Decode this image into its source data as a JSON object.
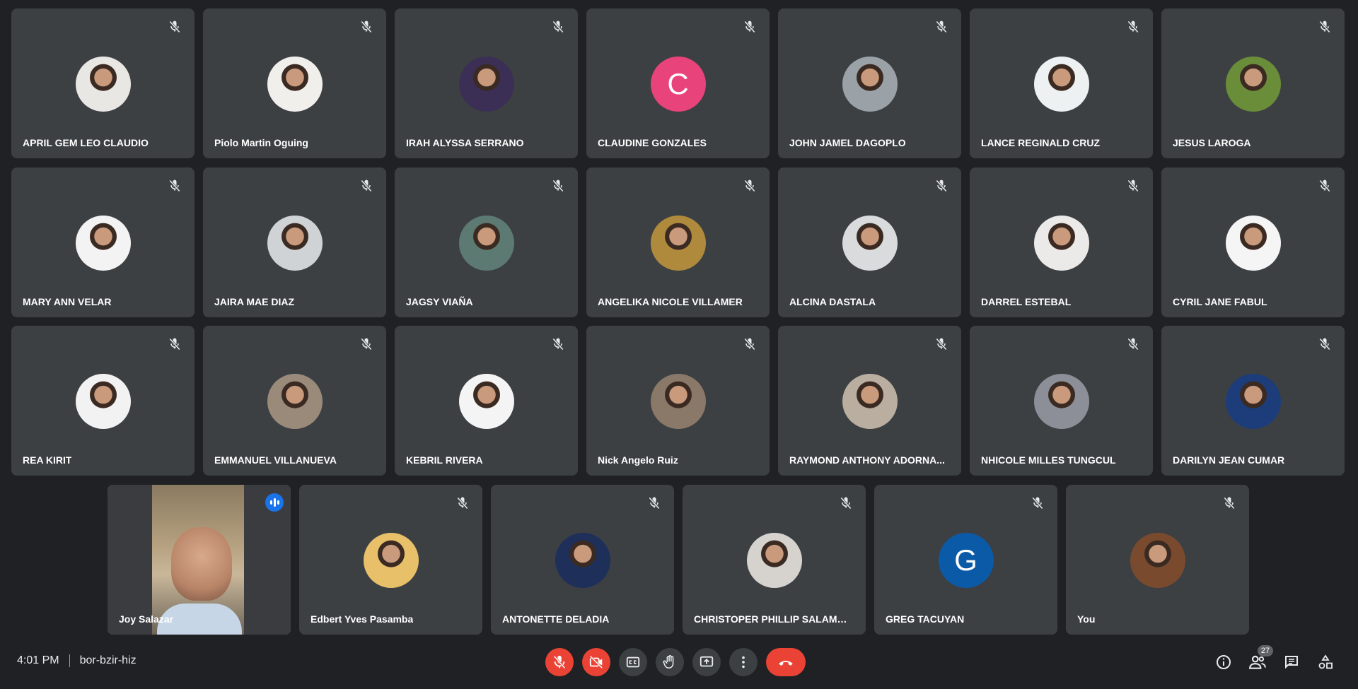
{
  "participants_row1": [
    {
      "name": "APRIL GEM LEO CLAUDIO",
      "avatar": "photo",
      "color": "#e9e7e3"
    },
    {
      "name": "Piolo Martin Oguing",
      "avatar": "photo",
      "color": "#f1efec"
    },
    {
      "name": "IRAH ALYSSA SERRANO",
      "avatar": "photo",
      "color": "#3c2f55"
    },
    {
      "name": "CLAUDINE GONZALES",
      "avatar": "letter",
      "letter": "C",
      "color": "#e8437a"
    },
    {
      "name": "JOHN JAMEL DAGOPLO",
      "avatar": "photo",
      "color": "#9aa1a7"
    },
    {
      "name": "LANCE REGINALD CRUZ",
      "avatar": "photo",
      "color": "#eef1f2"
    },
    {
      "name": "JESUS LAROGA",
      "avatar": "photo",
      "color": "#6a8d3a"
    }
  ],
  "participants_row2": [
    {
      "name": "MARY ANN VELAR",
      "avatar": "photo",
      "color": "#f3f3f3"
    },
    {
      "name": "JAIRA MAE DIAZ",
      "avatar": "photo",
      "color": "#cfd3d6"
    },
    {
      "name": "JAGSY VIAÑA",
      "avatar": "photo",
      "color": "#5c7a72"
    },
    {
      "name": "ANGELIKA NICOLE VILLAMER",
      "avatar": "photo",
      "color": "#b08a3c"
    },
    {
      "name": "ALCINA DASTALA",
      "avatar": "photo",
      "color": "#d9dbdd"
    },
    {
      "name": "DARREL ESTEBAL",
      "avatar": "photo",
      "color": "#eceae8"
    },
    {
      "name": "CYRIL JANE FABUL",
      "avatar": "photo",
      "color": "#f5f5f5"
    }
  ],
  "participants_row3": [
    {
      "name": "REA KIRIT",
      "avatar": "photo",
      "color": "#f2f2f2"
    },
    {
      "name": "EMMANUEL VILLANUEVA",
      "avatar": "photo",
      "color": "#9a8a7a"
    },
    {
      "name": "KEBRIL RIVERA",
      "avatar": "photo",
      "color": "#f4f4f4"
    },
    {
      "name": "Nick Angelo Ruiz",
      "avatar": "photo",
      "color": "#8a7868"
    },
    {
      "name": "RAYMOND ANTHONY ADORNA...",
      "avatar": "photo",
      "color": "#b9aea0"
    },
    {
      "name": "NHICOLE MILLES TUNGCUL",
      "avatar": "photo",
      "color": "#8d8f98"
    },
    {
      "name": "DARILYN JEAN CUMAR",
      "avatar": "photo",
      "color": "#1d3c7a"
    }
  ],
  "participants_row4": [
    {
      "name": "Joy Salazar",
      "avatar": "video",
      "speaking": true
    },
    {
      "name": "Edbert Yves Pasamba",
      "avatar": "photo",
      "color": "#e8c06a"
    },
    {
      "name": "ANTONETTE DELADIA",
      "avatar": "photo",
      "color": "#1e2f5a"
    },
    {
      "name": "CHRISTOPER PHILLIP SALAMAN...",
      "avatar": "photo",
      "color": "#d6d3cf"
    },
    {
      "name": "GREG TACUYAN",
      "avatar": "letter",
      "letter": "G",
      "color": "#0b5aa8"
    },
    {
      "name": "You",
      "avatar": "photo",
      "color": "#7a4a2e"
    }
  ],
  "bottom": {
    "time": "4:01 PM",
    "meeting_code": "bor-bzir-hiz",
    "participant_count": "27"
  },
  "controls": [
    {
      "name": "mic-off-button",
      "icon": "mic-off-icon"
    },
    {
      "name": "camera-off-button",
      "icon": "camera-off-icon"
    },
    {
      "name": "captions-button",
      "icon": "captions-icon"
    },
    {
      "name": "raise-hand-button",
      "icon": "hand-icon"
    },
    {
      "name": "present-button",
      "icon": "present-icon"
    },
    {
      "name": "more-options-button",
      "icon": "more-vert-icon"
    },
    {
      "name": "leave-call-button",
      "icon": "call-end-icon"
    }
  ]
}
